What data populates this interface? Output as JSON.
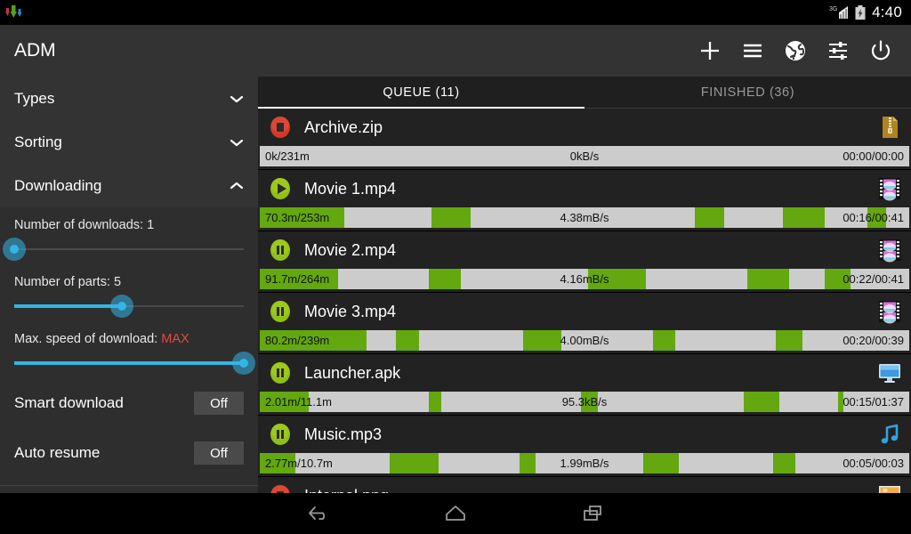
{
  "status_bar": {
    "notification_icon": "adm-download-arrows-icon",
    "network_label": "3G",
    "signal_icon": "signal-bars-icon",
    "battery_icon": "battery-icon",
    "time": "4:40"
  },
  "action_bar": {
    "title": "ADM",
    "actions": [
      {
        "name": "add-download-button",
        "icon": "plus-icon"
      },
      {
        "name": "menu-button",
        "icon": "hamburger-menu-icon"
      },
      {
        "name": "browser-button",
        "icon": "globe-icon"
      },
      {
        "name": "settings-button",
        "icon": "sliders-icon"
      },
      {
        "name": "exit-button",
        "icon": "power-icon"
      }
    ]
  },
  "sidebar": {
    "groups": [
      {
        "label": "Types",
        "expanded": false,
        "chevron": "chevron-down-icon"
      },
      {
        "label": "Sorting",
        "expanded": false,
        "chevron": "chevron-down-icon"
      },
      {
        "label": "Downloading",
        "expanded": true,
        "chevron": "chevron-up-icon"
      }
    ],
    "settings": {
      "downloads": {
        "label": "Number of downloads: 1",
        "value": 1,
        "percent": 0
      },
      "parts": {
        "label": "Number of parts: 5",
        "value": 5,
        "percent": 47
      },
      "max_speed": {
        "label_prefix": "Max. speed of download: ",
        "value": "MAX",
        "percent": 100,
        "value_color": "#e04a3f"
      },
      "smart_download": {
        "label": "Smart download",
        "state": "Off"
      },
      "auto_resume": {
        "label": "Auto resume",
        "state": "Off"
      }
    }
  },
  "tabs": [
    {
      "label": "QUEUE (11)",
      "active": true
    },
    {
      "label": "FINISHED (36)",
      "active": false
    }
  ],
  "colors": {
    "progress_fill": "#63a80f",
    "progress_track": "#cccccc",
    "accent": "#33b5e5",
    "stop": "#d03a2a",
    "play_pause": "#8fbf1a"
  },
  "downloads": [
    {
      "name": "Archive.zip",
      "state_icon": "stop-icon",
      "state": "stopped",
      "type_icon": "zip-file-icon",
      "size": "0k/231m",
      "speed": "0kB/s",
      "time": "00:00/00:00",
      "segments": []
    },
    {
      "name": "Movie 1.mp4",
      "state_icon": "play-icon",
      "state": "downloading",
      "type_icon": "video-file-icon",
      "size": "70.3m/253m",
      "speed": "4.38mB/s",
      "time": "00:16/00:41",
      "segments": [
        {
          "start": 0.0,
          "width": 13.0
        },
        {
          "start": 26.5,
          "width": 6.0
        },
        {
          "start": 67.0,
          "width": 4.5
        },
        {
          "start": 80.5,
          "width": 6.5
        },
        {
          "start": 93.5,
          "width": 3.0
        }
      ]
    },
    {
      "name": "Movie 2.mp4",
      "state_icon": "pause-icon",
      "state": "paused",
      "type_icon": "video-file-icon",
      "size": "91.7m/264m",
      "speed": "4.16mB/s",
      "time": "00:22/00:41",
      "segments": [
        {
          "start": 0.0,
          "width": 12.0
        },
        {
          "start": 26.0,
          "width": 5.0
        },
        {
          "start": 50.5,
          "width": 9.0
        },
        {
          "start": 75.0,
          "width": 6.5
        },
        {
          "start": 87.0,
          "width": 4.0
        }
      ]
    },
    {
      "name": "Movie 3.mp4",
      "state_icon": "pause-icon",
      "state": "paused",
      "type_icon": "video-file-icon",
      "size": "80.2m/239m",
      "speed": "4.00mB/s",
      "time": "00:20/00:39",
      "segments": [
        {
          "start": 0.0,
          "width": 16.5
        },
        {
          "start": 21.0,
          "width": 3.5
        },
        {
          "start": 40.5,
          "width": 6.0
        },
        {
          "start": 60.5,
          "width": 3.5
        },
        {
          "start": 79.5,
          "width": 4.0
        }
      ]
    },
    {
      "name": "Launcher.apk",
      "state_icon": "pause-icon",
      "state": "paused",
      "type_icon": "application-file-icon",
      "size": "2.01m/11.1m",
      "speed": "95.3kB/s",
      "time": "00:15/01:37",
      "segments": [
        {
          "start": 0.0,
          "width": 7.5
        },
        {
          "start": 26.0,
          "width": 2.0
        },
        {
          "start": 49.5,
          "width": 2.5
        },
        {
          "start": 74.5,
          "width": 5.5
        },
        {
          "start": 89.0,
          "width": 0.8
        }
      ]
    },
    {
      "name": "Music.mp3",
      "state_icon": "pause-icon",
      "state": "paused",
      "type_icon": "audio-file-icon",
      "size": "2.77m/10.7m",
      "speed": "1.99mB/s",
      "time": "00:05/00:03",
      "segments": [
        {
          "start": 0.0,
          "width": 5.5
        },
        {
          "start": 20.0,
          "width": 7.5
        },
        {
          "start": 40.0,
          "width": 2.5
        },
        {
          "start": 59.0,
          "width": 5.5
        },
        {
          "start": 79.0,
          "width": 3.5
        }
      ]
    },
    {
      "name": "Internal.png",
      "state_icon": "stop-icon",
      "state": "stopped",
      "type_icon": "image-file-icon",
      "size": "",
      "speed": "",
      "time": "",
      "segments": []
    }
  ],
  "navbar": [
    {
      "name": "nav-back-button",
      "icon": "back-arrow-icon"
    },
    {
      "name": "nav-home-button",
      "icon": "home-icon"
    },
    {
      "name": "nav-recents-button",
      "icon": "recents-icon"
    }
  ]
}
